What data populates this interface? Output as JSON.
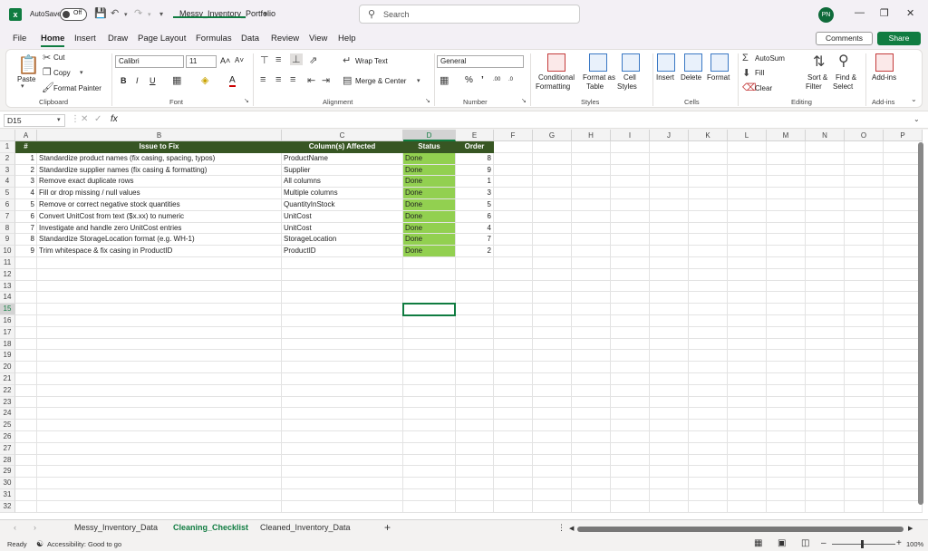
{
  "title_bar": {
    "autosave_label": "AutoSave",
    "autosave_state": "Off",
    "document_title": "Messy_Inventory_Portfolio",
    "search_placeholder": "Search",
    "user_initials": "PN"
  },
  "menu": {
    "tabs": [
      "File",
      "Home",
      "Insert",
      "Draw",
      "Page Layout",
      "Formulas",
      "Data",
      "Review",
      "View",
      "Help"
    ],
    "active_tab": "Home",
    "comments_label": "Comments",
    "share_label": "Share"
  },
  "ribbon": {
    "clipboard": {
      "paste": "Paste",
      "cut": "Cut",
      "copy": "Copy",
      "format_painter": "Format Painter",
      "label": "Clipboard"
    },
    "font": {
      "name": "Calibri",
      "size": "11",
      "label": "Font"
    },
    "alignment": {
      "wrap_text": "Wrap Text",
      "merge_center": "Merge & Center",
      "label": "Alignment"
    },
    "number": {
      "format": "General",
      "label": "Number"
    },
    "styles": {
      "conditional": "Conditional",
      "conditional2": "Formatting",
      "format_as": "Format as",
      "format_as2": "Table",
      "cell_styles": "Cell",
      "cell_styles2": "Styles",
      "label": "Styles"
    },
    "cells": {
      "insert": "Insert",
      "delete": "Delete",
      "format": "Format",
      "label": "Cells"
    },
    "editing": {
      "autosum": "AutoSum",
      "fill": "Fill",
      "clear": "Clear",
      "sort": "Sort &",
      "sort2": "Filter",
      "find": "Find &",
      "find2": "Select",
      "label": "Editing"
    },
    "addins": {
      "addins": "Add-ins",
      "label": "Add-ins"
    }
  },
  "formula_bar": {
    "name_box": "D15",
    "fx": "fx",
    "content": ""
  },
  "grid": {
    "columns": [
      "A",
      "B",
      "C",
      "D",
      "E",
      "F",
      "G",
      "H",
      "I",
      "J",
      "K",
      "L",
      "M",
      "N",
      "O",
      "P"
    ],
    "selected_column": "D",
    "selected_row": 15,
    "row_count": 32,
    "headers": [
      "#",
      "Issue to Fix",
      "Column(s) Affected",
      "Status",
      "Order"
    ],
    "rows": [
      [
        "1",
        "Standardize product names (fix casing, spacing, typos)",
        "ProductName",
        "Done",
        "8"
      ],
      [
        "2",
        "Standardize supplier names (fix casing & formatting)",
        "Supplier",
        "Done",
        "9"
      ],
      [
        "3",
        "Remove exact duplicate rows",
        "All columns",
        "Done",
        "1"
      ],
      [
        "4",
        "Fill or drop missing / null values",
        "Multiple columns",
        "Done",
        "3"
      ],
      [
        "5",
        "Remove or correct negative stock quantities",
        "QuantityInStock",
        "Done",
        "5"
      ],
      [
        "6",
        "Convert UnitCost from text ($x.xx) to numeric",
        "UnitCost",
        "Done",
        "6"
      ],
      [
        "7",
        "Investigate and handle zero UnitCost entries",
        "UnitCost",
        "Done",
        "4"
      ],
      [
        "8",
        "Standardize StorageLocation format (e.g. WH-1)",
        "StorageLocation",
        "Done",
        "7"
      ],
      [
        "9",
        "Trim whitespace & fix casing in ProductID",
        "ProductID",
        "Done",
        "2"
      ]
    ]
  },
  "sheet_tabs": {
    "tabs": [
      "Messy_Inventory_Data",
      "Cleaning_Checklist",
      "Cleaned_Inventory_Data"
    ],
    "active": "Cleaning_Checklist"
  },
  "status_bar": {
    "ready": "Ready",
    "accessibility": "Accessibility: Good to go",
    "zoom": "100%"
  }
}
